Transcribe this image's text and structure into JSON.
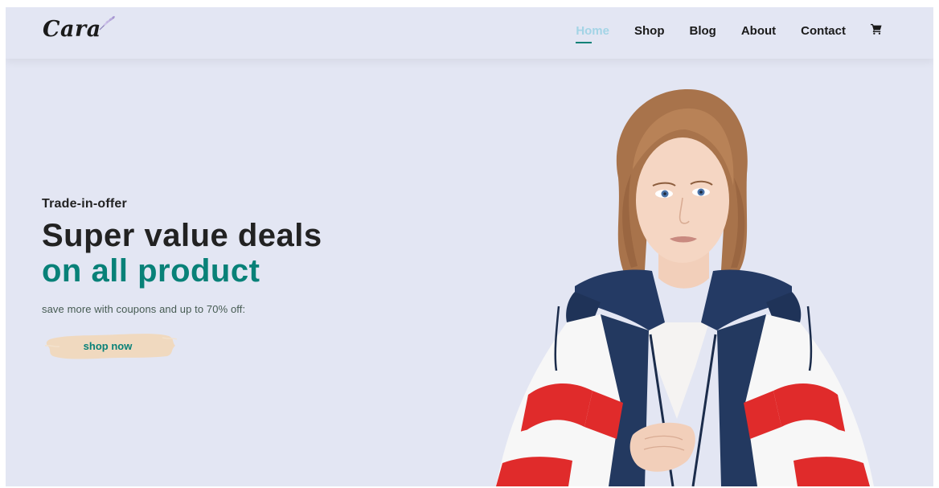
{
  "brand": {
    "name": "Cara"
  },
  "nav": {
    "items": [
      {
        "label": "Home",
        "active": true
      },
      {
        "label": "Shop",
        "active": false
      },
      {
        "label": "Blog",
        "active": false
      },
      {
        "label": "About",
        "active": false
      },
      {
        "label": "Contact",
        "active": false
      }
    ],
    "cart_icon": "cart-icon"
  },
  "hero": {
    "kicker": "Trade-in-offer",
    "title_line1": "Super value deals",
    "title_line2": "on all product",
    "subtitle": "save more with coupons and up to 70% off:",
    "cta_label": "shop now"
  },
  "colors": {
    "background": "#e3e6f3",
    "accent": "#088178",
    "nav_active": "#a3d4e6",
    "button_brush": "#f0d9bf",
    "text_dark": "#222222"
  }
}
